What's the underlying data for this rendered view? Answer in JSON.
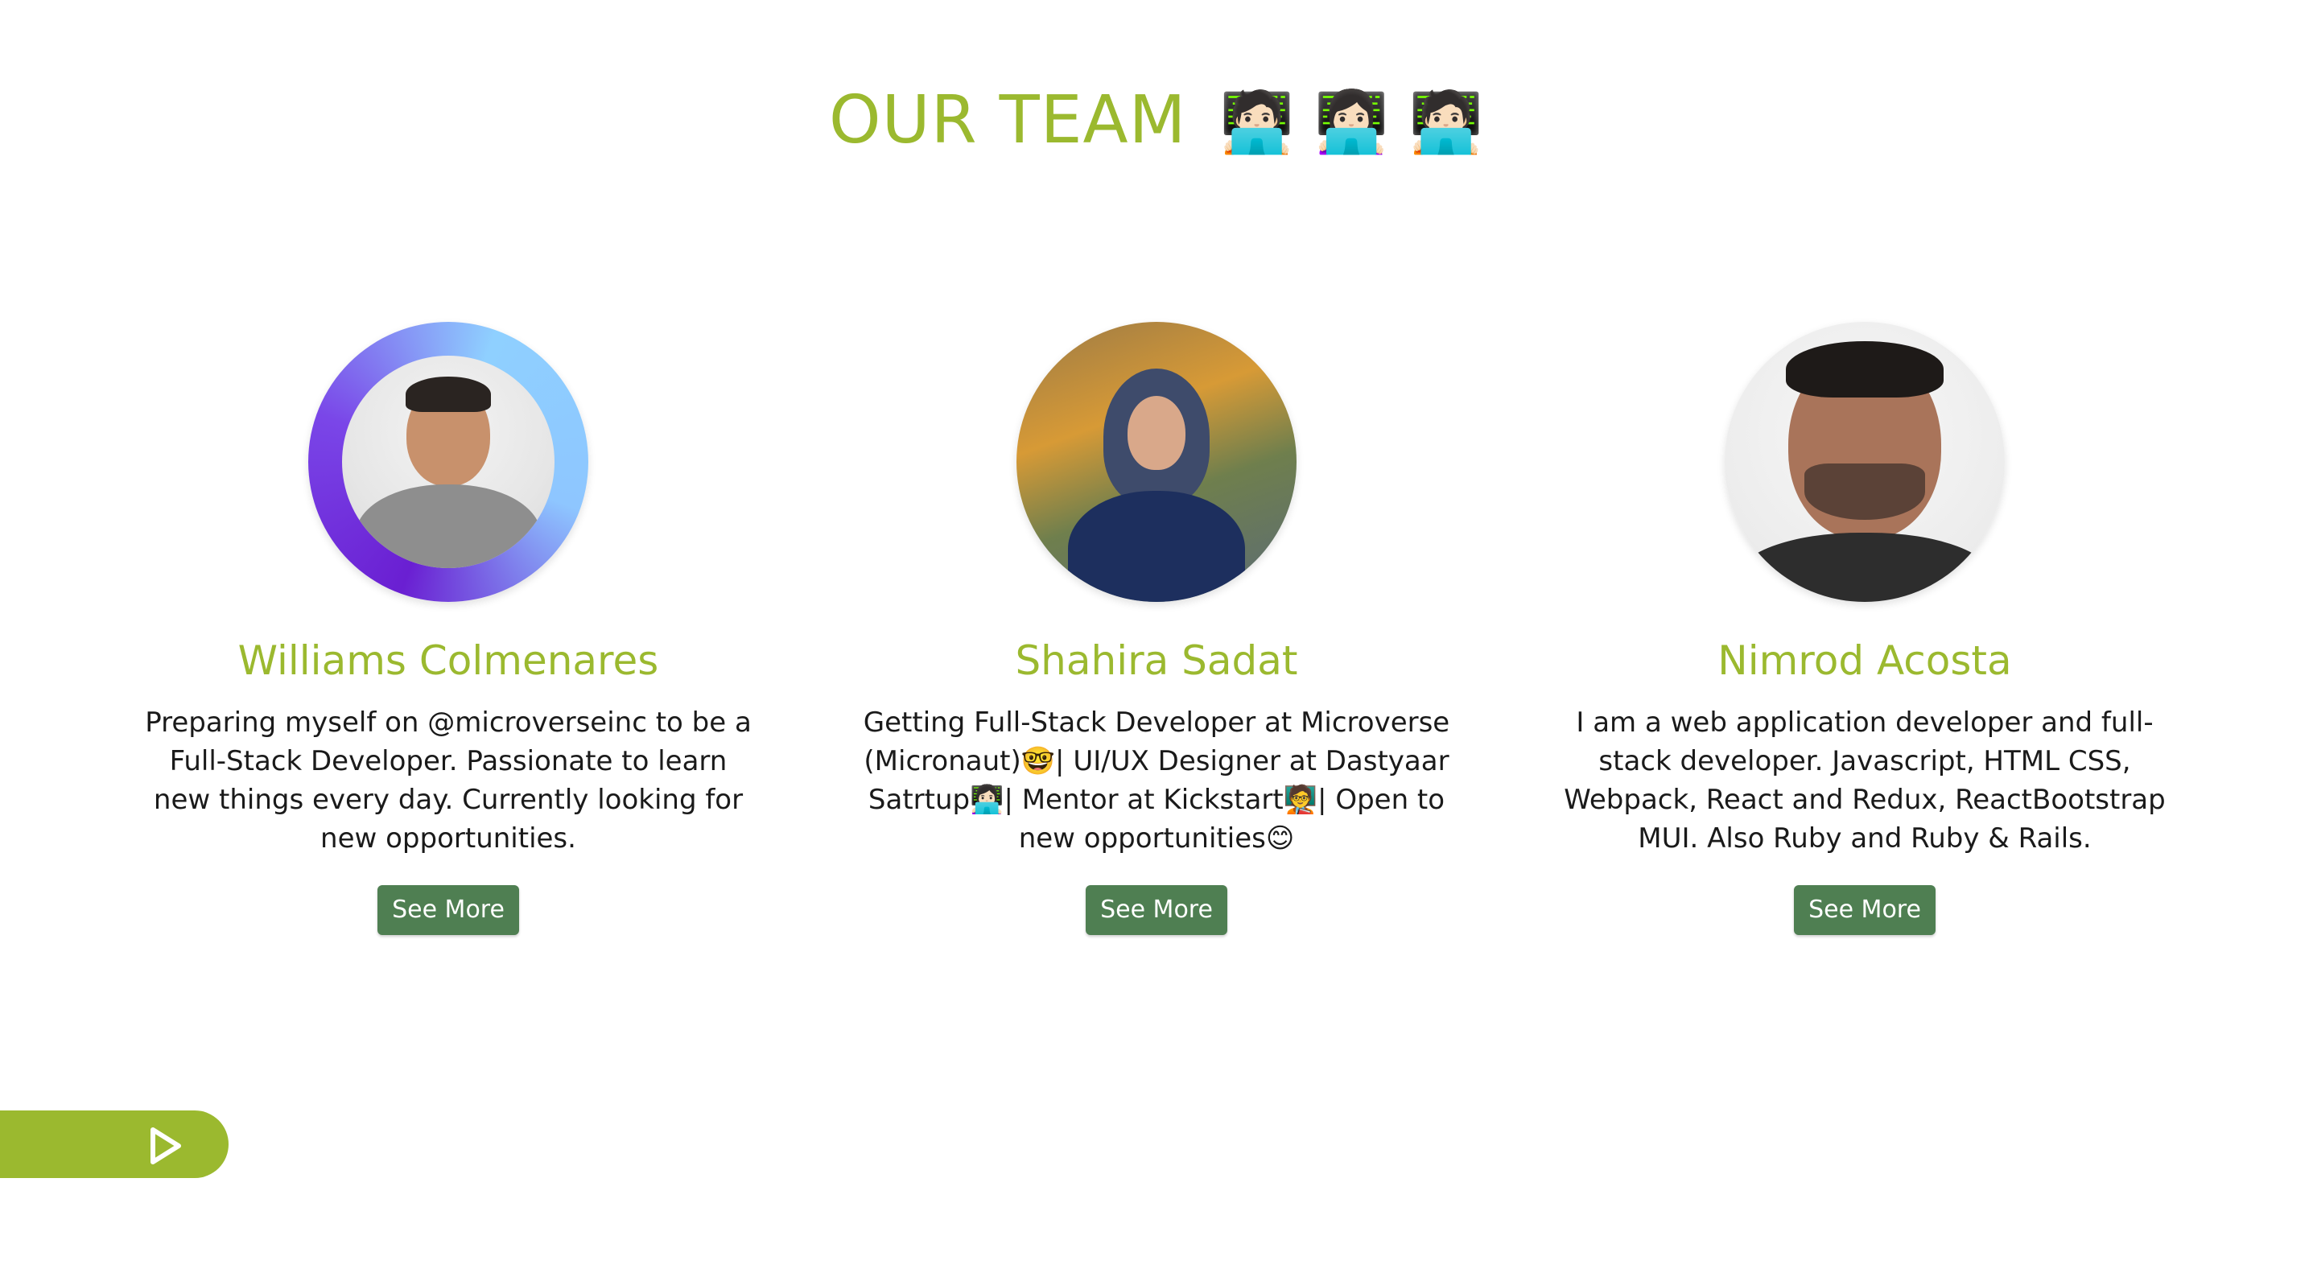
{
  "page": {
    "title": "OUR TEAM",
    "title_emojis": "🧑🏻‍💻 👩🏻‍💻 🧑🏻‍💻"
  },
  "team": [
    {
      "name": "Williams Colmenares",
      "description": "Preparing myself on @microverseinc to be a Full-Stack Developer. Passionate to learn new things every day. Currently looking for new opportunities.",
      "button": "See More"
    },
    {
      "name": "Shahira Sadat",
      "description": "Getting Full-Stack Developer at Microverse (Micronaut)🤓| UI/UX Designer at Dastyaar Satrtup👩🏻‍💻| Mentor at Kickstart🧑‍🏫| Open to new opportunities😊",
      "button": "See More"
    },
    {
      "name": "Nimrod Acosta",
      "description": "I am a web application developer and full-stack developer. Javascript, HTML CSS, Webpack, React and Redux, ReactBootstrap MUI. Also Ruby and Ruby & Rails.",
      "button": "See More"
    }
  ],
  "floating_control": {
    "icon": "play-icon"
  },
  "colors": {
    "accent": "#9bb92f",
    "button": "#4f7f52",
    "text": "#1a1a1a"
  }
}
